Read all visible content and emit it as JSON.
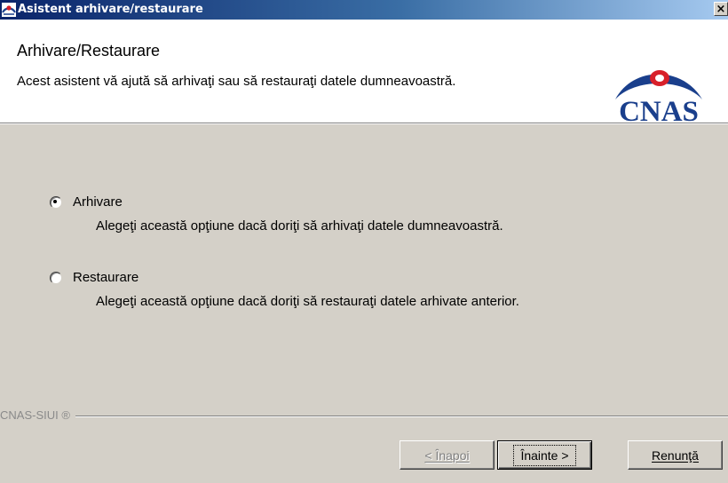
{
  "window": {
    "title": "Asistent arhivare/restaurare",
    "close_glyph": "×"
  },
  "header": {
    "title": "Arhivare/Restaurare",
    "subtitle": "Acest asistent vă ajută să arhivaţi sau să restauraţi datele dumneavoastră.",
    "logo_text": "CNAS"
  },
  "options": [
    {
      "label": "Arhivare",
      "description": "Alegeţi această opţiune dacă doriţi să arhivaţi datele dumneavoastră.",
      "selected": true
    },
    {
      "label": "Restaurare",
      "description": "Alegeţi această opţiune dacă doriţi să restauraţi datele arhivate anterior.",
      "selected": false
    }
  ],
  "footer": {
    "brand": "CNAS-SIUI ®"
  },
  "buttons": {
    "back": "< Înapoi",
    "next": "Înainte >",
    "cancel": "Renunţă"
  },
  "colors": {
    "titlebar_start": "#0a246a",
    "titlebar_end": "#a6caf0",
    "logo_blue": "#1a3f8c",
    "logo_red": "#d8202a",
    "dialog_bg": "#d4d0c8"
  },
  "icons": {
    "app": "cnas-logo-icon",
    "close": "close-icon"
  }
}
